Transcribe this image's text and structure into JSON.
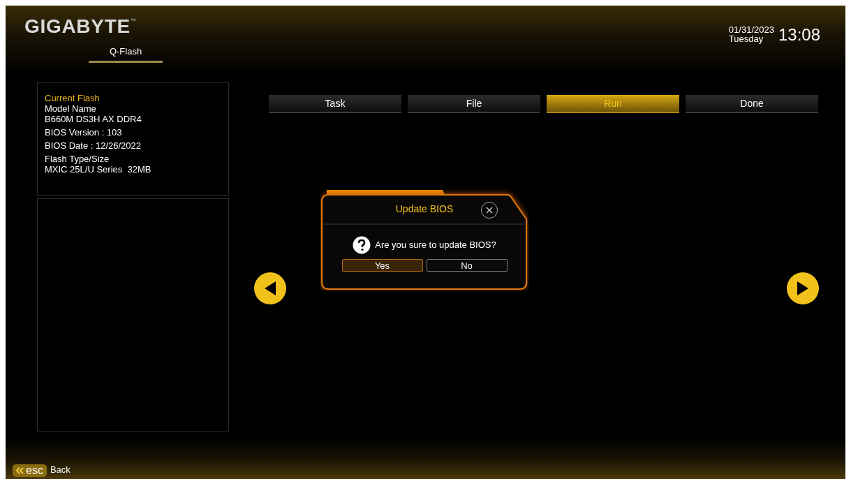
{
  "brand": {
    "logo": "GIGABYTE",
    "trademark": "™"
  },
  "mode_tab": {
    "label": "Q-Flash",
    "selected": true
  },
  "clock": {
    "date": "01/31/2023",
    "weekday": "Tuesday",
    "time": "13:08"
  },
  "info_panel": {
    "heading": "Current Flash",
    "items": [
      {
        "lines": [
          "Model Name",
          "B660M DS3H AX DDR4"
        ]
      },
      {
        "lines": [
          "BIOS Version : 103"
        ]
      },
      {
        "lines": [
          "BIOS Date : 12/26/2022"
        ]
      },
      {
        "lines": [
          "Flash Type/Size",
          "MXIC 25L/U Series  32MB"
        ]
      }
    ]
  },
  "steps": [
    {
      "label": "Task",
      "selected": false
    },
    {
      "label": "File",
      "selected": false
    },
    {
      "label": "Run",
      "selected": true
    },
    {
      "label": "Done",
      "selected": false
    }
  ],
  "dialog": {
    "title": "Update BIOS",
    "message": "Are you sure to update BIOS?",
    "buttons": [
      {
        "label": "Yes",
        "selected": true
      },
      {
        "label": "No",
        "selected": false
      }
    ]
  },
  "footer": {
    "key": "esc",
    "label": "Back"
  }
}
